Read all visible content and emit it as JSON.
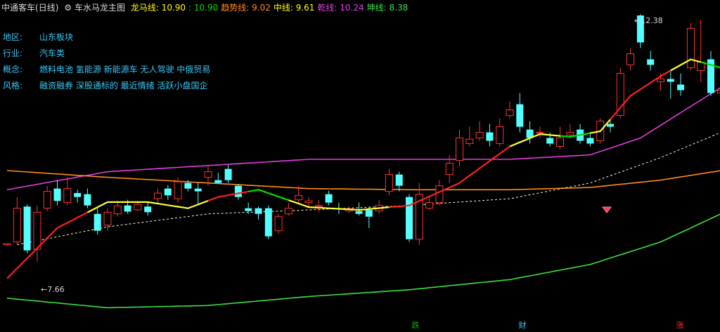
{
  "header": {
    "stock_name": "中通客车",
    "period": "(日线)",
    "indicator_name": "车水马龙主图",
    "lines": [
      {
        "label": "龙马线:",
        "value": "10.90",
        "color": "#ffff00"
      },
      {
        "label": "",
        "value": ": 10.90",
        "color": "#00e000"
      },
      {
        "label": "趋势线:",
        "value": "9.02",
        "color": "#ff8c1a"
      },
      {
        "label": "中线:",
        "value": "9.61",
        "color": "#ffff00"
      },
      {
        "label": "乾线:",
        "value": "10.24",
        "color": "#e040e0"
      },
      {
        "label": "坤线:",
        "value": "8.38",
        "color": "#40e040"
      }
    ]
  },
  "info": [
    {
      "key": "地区",
      "value": "山东板块"
    },
    {
      "key": "行业",
      "value": "汽车类"
    },
    {
      "key": "概念",
      "value": "燃料电池 氢能源 新能源车 无人驾驶 中俄贸易"
    },
    {
      "key": "风格",
      "value": "融资融券 深股通标的 最近情绪 活跃小盘国企"
    }
  ],
  "price_labels": {
    "high": "12.38",
    "low": "7.66"
  },
  "badges": [
    {
      "text": "跌",
      "color": "#00c000"
    },
    {
      "text": "财",
      "color": "#39c6f5"
    },
    {
      "text": "涨",
      "color": "#ff3030"
    }
  ],
  "colors": {
    "up": "#ff3232",
    "down": "#54ffff",
    "background": "#000000"
  },
  "chart_data": {
    "type": "candlestick",
    "ylim": [
      7.0,
      12.6
    ],
    "candles": [
      [
        8.3,
        8.32,
        8.3,
        8.28
      ],
      [
        8.35,
        8.95,
        9.15,
        8.3
      ],
      [
        8.98,
        8.2,
        9.02,
        8.15
      ],
      [
        8.22,
        8.88,
        9.0,
        8.0
      ],
      [
        8.95,
        9.25,
        9.35,
        8.9
      ],
      [
        9.3,
        9.08,
        9.45,
        9.0
      ],
      [
        9.05,
        9.3,
        9.5,
        9.0
      ],
      [
        9.22,
        9.15,
        9.28,
        9.05
      ],
      [
        9.2,
        9.0,
        9.3,
        8.95
      ],
      [
        8.85,
        8.55,
        8.95,
        8.48
      ],
      [
        8.65,
        8.88,
        8.95,
        8.55
      ],
      [
        8.85,
        8.99,
        9.08,
        8.8
      ],
      [
        9.0,
        8.89,
        9.1,
        8.85
      ],
      [
        8.92,
        9.02,
        9.08,
        8.9
      ],
      [
        8.98,
        8.88,
        9.05,
        8.82
      ],
      [
        9.12,
        9.22,
        9.3,
        9.05
      ],
      [
        9.3,
        9.18,
        9.36,
        9.1
      ],
      [
        9.12,
        9.42,
        9.5,
        9.05
      ],
      [
        9.4,
        9.3,
        9.45,
        9.25
      ],
      [
        9.3,
        9.25,
        9.4,
        9.0
      ],
      [
        9.5,
        9.6,
        9.7,
        9.35
      ],
      [
        9.45,
        9.4,
        9.58,
        9.38
      ],
      [
        9.65,
        9.45,
        9.72,
        9.4
      ],
      [
        9.35,
        9.15,
        9.38,
        9.1
      ],
      [
        8.95,
        8.9,
        9.05,
        8.85
      ],
      [
        8.95,
        8.85,
        8.98,
        8.75
      ],
      [
        8.95,
        8.45,
        9.0,
        8.4
      ],
      [
        8.55,
        8.8,
        8.85,
        8.5
      ],
      [
        8.85,
        8.95,
        9.05,
        8.82
      ],
      [
        9.1,
        9.18,
        9.35,
        9.05
      ],
      [
        9.05,
        9.08,
        9.15,
        8.95
      ],
      [
        8.98,
        9.0,
        9.1,
        8.88
      ],
      [
        9.2,
        9.05,
        9.26,
        9.0
      ],
      [
        8.95,
        8.94,
        9.05,
        8.85
      ],
      [
        8.9,
        8.94,
        8.98,
        8.86
      ],
      [
        8.9,
        8.85,
        9.05,
        8.82
      ],
      [
        8.92,
        8.8,
        8.98,
        8.6
      ],
      [
        8.9,
        9.0,
        9.1,
        8.85
      ],
      [
        9.25,
        9.55,
        9.65,
        9.18
      ],
      [
        9.55,
        9.35,
        9.6,
        9.25
      ],
      [
        9.15,
        8.4,
        9.2,
        8.35
      ],
      [
        8.4,
        9.2,
        9.4,
        8.3
      ],
      [
        8.95,
        9.05,
        9.15,
        8.92
      ],
      [
        9.05,
        9.35,
        9.45,
        9.0
      ],
      [
        9.55,
        9.75,
        9.9,
        9.4
      ],
      [
        9.8,
        10.2,
        10.35,
        9.7
      ],
      [
        10.1,
        10.18,
        10.4,
        10.05
      ],
      [
        10.2,
        10.3,
        10.5,
        10.15
      ],
      [
        10.3,
        10.15,
        10.45,
        10.05
      ],
      [
        10.1,
        10.4,
        10.55,
        10.05
      ],
      [
        10.6,
        10.7,
        10.85,
        10.55
      ],
      [
        10.8,
        10.4,
        11.0,
        10.3
      ],
      [
        10.35,
        10.2,
        10.5,
        10.1
      ],
      [
        10.3,
        10.3,
        10.4,
        10.2
      ],
      [
        10.2,
        10.1,
        10.3,
        10.05
      ],
      [
        10.05,
        10.2,
        10.4,
        10.0
      ],
      [
        10.25,
        10.3,
        10.45,
        10.2
      ],
      [
        10.35,
        10.15,
        10.45,
        10.1
      ],
      [
        10.2,
        10.1,
        10.3,
        10.05
      ],
      [
        10.15,
        10.5,
        10.55,
        10.1
      ],
      [
        10.45,
        10.4,
        10.5,
        10.3
      ],
      [
        10.6,
        11.35,
        11.45,
        10.55
      ],
      [
        11.5,
        11.7,
        11.8,
        11.4
      ],
      [
        12.38,
        11.9,
        12.4,
        11.8
      ],
      [
        11.6,
        11.5,
        11.75,
        11.4
      ],
      [
        11.2,
        11.25,
        11.35,
        11.05
      ],
      [
        11.25,
        11.2,
        11.4,
        10.9
      ],
      [
        11.15,
        11.05,
        11.35,
        10.95
      ],
      [
        11.45,
        12.15,
        12.25,
        11.4
      ],
      [
        11.4,
        11.55,
        12.3,
        11.2
      ],
      [
        11.6,
        11.0,
        11.75,
        10.95
      ],
      [
        11.0,
        11.05,
        11.2,
        10.9
      ]
    ],
    "series": [
      {
        "name": "乾线",
        "color": "#e040e0",
        "keypoints": [
          [
            0,
            9.28
          ],
          [
            10,
            9.6
          ],
          [
            30,
            9.82
          ],
          [
            50,
            9.82
          ],
          [
            58,
            9.9
          ],
          [
            63,
            10.2
          ],
          [
            71,
            11.1
          ]
        ]
      },
      {
        "name": "趋势线",
        "color": "#ff8c1a",
        "keypoints": [
          [
            0,
            9.62
          ],
          [
            10,
            9.5
          ],
          [
            20,
            9.4
          ],
          [
            30,
            9.3
          ],
          [
            40,
            9.28
          ],
          [
            50,
            9.28
          ],
          [
            58,
            9.32
          ],
          [
            65,
            9.45
          ],
          [
            71,
            9.62
          ]
        ]
      },
      {
        "name": "中线",
        "color": "#ffffcc",
        "dashed": true,
        "keypoints": [
          [
            1,
            8.3
          ],
          [
            10,
            8.62
          ],
          [
            20,
            8.85
          ],
          [
            30,
            8.92
          ],
          [
            40,
            9.0
          ],
          [
            50,
            9.12
          ],
          [
            58,
            9.4
          ],
          [
            65,
            9.85
          ],
          [
            71,
            10.3
          ]
        ]
      },
      {
        "name": "坤线",
        "color": "#40e040",
        "keypoints": [
          [
            0,
            7.35
          ],
          [
            10,
            7.18
          ],
          [
            20,
            7.22
          ],
          [
            30,
            7.38
          ],
          [
            40,
            7.5
          ],
          [
            50,
            7.68
          ],
          [
            58,
            7.95
          ],
          [
            65,
            8.35
          ],
          [
            71,
            8.85
          ]
        ]
      }
    ],
    "dragon_line": {
      "name": "龙马线",
      "keypoints": [
        [
          0,
          7.7
        ],
        [
          5,
          8.6
        ],
        [
          10,
          9.06
        ],
        [
          14,
          9.06
        ],
        [
          18,
          8.95
        ],
        [
          21,
          9.15
        ],
        [
          25,
          9.28
        ],
        [
          30,
          8.97
        ],
        [
          35,
          8.92
        ],
        [
          40,
          9.0
        ],
        [
          45,
          9.4
        ],
        [
          50,
          10.05
        ],
        [
          53,
          10.27
        ],
        [
          56,
          10.22
        ],
        [
          59,
          10.32
        ],
        [
          62,
          10.95
        ],
        [
          65,
          11.3
        ],
        [
          68,
          11.6
        ],
        [
          71,
          11.45
        ]
      ],
      "color_segments": [
        [
          0,
          5,
          "#ff2020"
        ],
        [
          5,
          8,
          "#ff2020"
        ],
        [
          8,
          12,
          "#ffff30"
        ],
        [
          12,
          16,
          "#ffff30"
        ],
        [
          16,
          20,
          "#ffff30"
        ],
        [
          20,
          24,
          "#ff2020"
        ],
        [
          24,
          28,
          "#00e000"
        ],
        [
          28,
          34,
          "#ffff30"
        ],
        [
          34,
          38,
          "#ffff30"
        ],
        [
          38,
          44,
          "#ff2020"
        ],
        [
          44,
          50,
          "#ff2020"
        ],
        [
          50,
          55,
          "#ffff30"
        ],
        [
          55,
          58,
          "#00e000"
        ],
        [
          58,
          60,
          "#ffff30"
        ],
        [
          60,
          66,
          "#ff2020"
        ],
        [
          66,
          69,
          "#ffff30"
        ],
        [
          69,
          71,
          "#00e000"
        ]
      ]
    }
  }
}
